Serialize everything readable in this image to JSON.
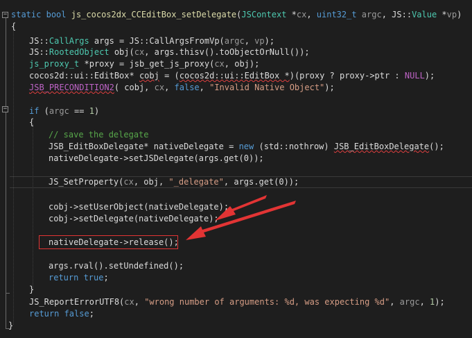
{
  "code": {
    "line1_static": "static",
    "line1_bool": "bool",
    "line1_fn": "js_cocos2dx_CCEditBox_setDelegate",
    "line1_open": "(",
    "line1_jsctx": "JSContext",
    "line1_star_cx": " *",
    "line1_cx": "cx",
    "line1_comma1": ", ",
    "line1_uint": "uint32_t",
    "line1_argc": " argc",
    "line1_comma2": ", ",
    "line1_js": "JS",
    "line1_colons": "::",
    "line1_value": "Value",
    "line1_star_vp": " *",
    "line1_vp": "vp",
    "line1_close": ")",
    "brace_open": "{",
    "line3_js": "JS",
    "line3_c1": "::",
    "line3_callargs": "CallArgs",
    "line3_mid": " args = JS::CallArgsFromVp(",
    "line3_argc": "argc",
    "line3_comma": ", ",
    "line3_vp": "vp",
    "line3_end": ");",
    "line4_js": "JS",
    "line4_c1": "::",
    "line4_rooted": "RootedObject",
    "line4_obj": " obj(",
    "line4_cx": "cx",
    "line4_end": ", args.thisv().toObjectOrNull());",
    "line5_type": "js_proxy_t",
    "line5_mid": " *proxy = jsb_get_js_proxy(",
    "line5_cx": "cx",
    "line5_end": ", obj);",
    "line6_a": "cocos2d::ui::EditBox* ",
    "line6_cobj": "cobj",
    "line6_b": " = (",
    "line6_c": "cocos2d::ui::EditBox *",
    "line6_d": ")(proxy ? proxy->ptr : ",
    "line6_null": "NULL",
    "line6_e": ");",
    "line7_macro": "JSB_PRECONDITION2",
    "line7_mid": "( cobj, ",
    "line7_cx": "cx",
    "line7_comma": ", ",
    "line7_false": "false",
    "line7_comma2": ", ",
    "line7_str": "\"Invalid Native Object\"",
    "line7_end": ");",
    "line9_if": "if",
    "line9_mid": " (",
    "line9_argc": "argc",
    "line9_eq": " == ",
    "line9_num": "1",
    "line9_end": ")",
    "line10_brace": "{",
    "line11_comment": "// save the delegate",
    "line12_type": "JSB_EditBoxDelegate",
    "line12_mid": "* nativeDelegate = ",
    "line12_new": "new",
    "line12_mid2": " (std::nothrow) ",
    "line12_type2": "JSB_EditBoxDelegate",
    "line12_end": "();",
    "line13": "nativeDelegate->setJSDelegate(args.get(0));",
    "line15_fn": "JS_SetProperty(",
    "line15_cx": "cx",
    "line15_mid": ", obj, ",
    "line15_str": "\"_delegate\"",
    "line15_end": ", args.get(0));",
    "line17": "cobj->setUserObject(nativeDelegate);",
    "line18": "cobj->setDelegate(nativeDelegate);",
    "line20": "nativeDelegate->release();",
    "line22": "args.rval().setUndefined();",
    "line23_return": "return",
    "line23_true": " true",
    "line23_end": ";",
    "line24_brace": "}",
    "line25_fn": "JS_ReportErrorUTF8(",
    "line25_cx": "cx",
    "line25_comma": ", ",
    "line25_str": "\"wrong number of arguments: %d, was expecting %d\"",
    "line25_comma2": ", ",
    "line25_argc": "argc",
    "line25_comma3": ", ",
    "line25_num": "1",
    "line25_end": ");",
    "line26_return": "return",
    "line26_false": " false",
    "line26_end": ";",
    "brace_close": "}"
  },
  "fold_icon_symbol": "−",
  "colors": {
    "background": "#1e1e1e",
    "keyword": "#569cd6",
    "type": "#4ec9b0",
    "comment": "#57a64a",
    "string": "#d69d85",
    "annotation": "#e23434"
  },
  "icons": [
    "fold-collapse-icon",
    "annotation-arrow-icon"
  ]
}
